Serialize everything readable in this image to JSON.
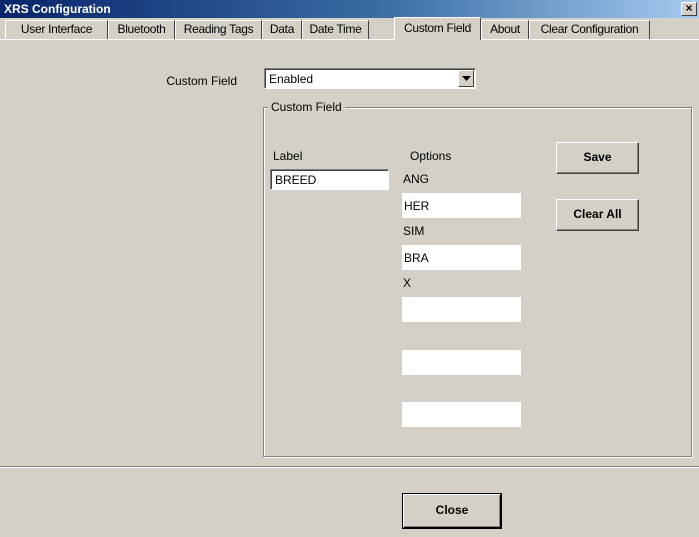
{
  "window": {
    "title": "XRS Configuration",
    "close_glyph": "×"
  },
  "tabs": [
    {
      "label": "User Interface"
    },
    {
      "label": "Bluetooth"
    },
    {
      "label": "Reading Tags"
    },
    {
      "label": "Data"
    },
    {
      "label": "Date Time"
    },
    {
      "label": "Custom Field",
      "active": true
    },
    {
      "label": "About"
    },
    {
      "label": "Clear Configuration"
    }
  ],
  "custom_field": {
    "label": "Custom Field",
    "select_value": "Enabled"
  },
  "group": {
    "title": "Custom Field",
    "label_caption": "Label",
    "options_caption": "Options",
    "label_value": "BREED",
    "options": [
      "ANG",
      "HER",
      "SIM",
      "BRA",
      "X",
      "",
      "",
      ""
    ]
  },
  "buttons": {
    "save": "Save",
    "clear_all": "Clear All",
    "close": "Close"
  }
}
